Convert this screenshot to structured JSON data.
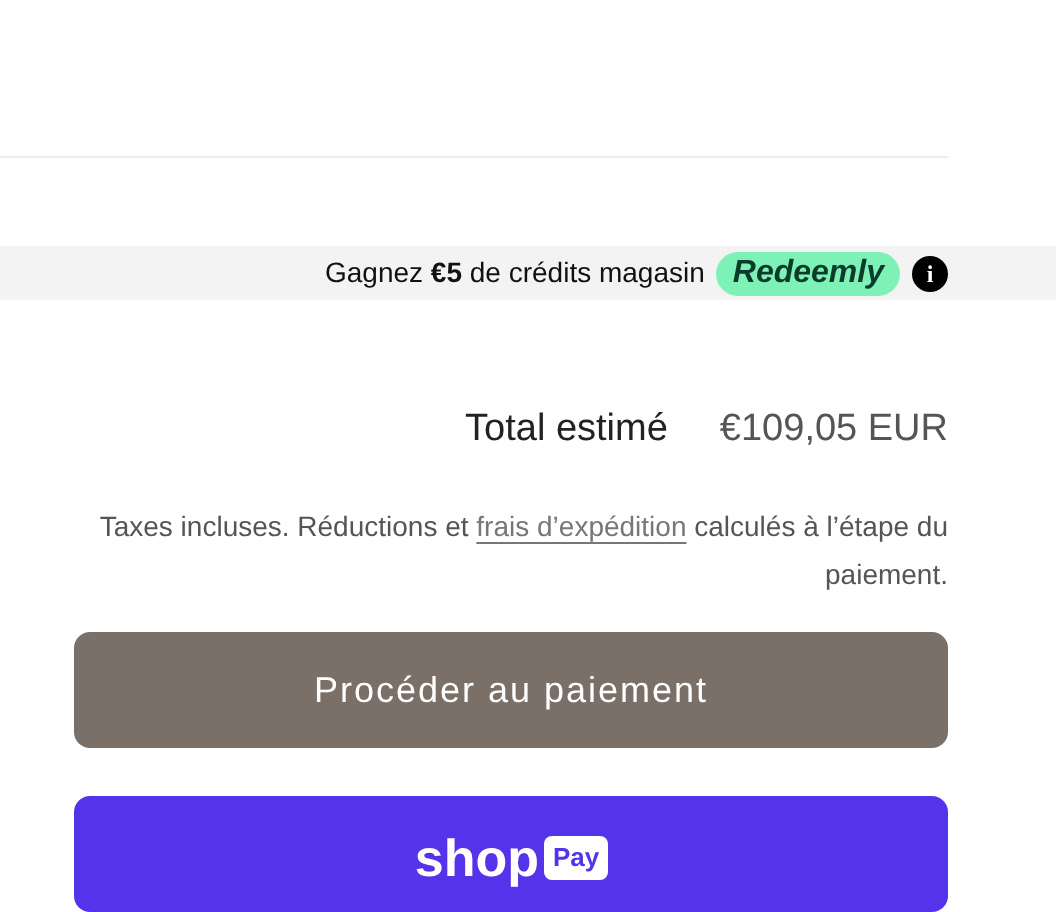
{
  "rewards_banner": {
    "text": "Gagnez **€5** de crédits magasin",
    "brand": "Redeemly",
    "info": "i"
  },
  "total": {
    "label": "Total estimé",
    "amount": "€109,05 EUR"
  },
  "tax_note": {
    "before": "Taxes incluses. Réductions et",
    "link": "frais d’expédition",
    "after": "calculés à l’étape du paiement."
  },
  "checkout_button": {
    "label": "Procéder au paiement"
  },
  "shop_pay_button": {
    "logo": "shop",
    "badge": "Pay"
  }
}
